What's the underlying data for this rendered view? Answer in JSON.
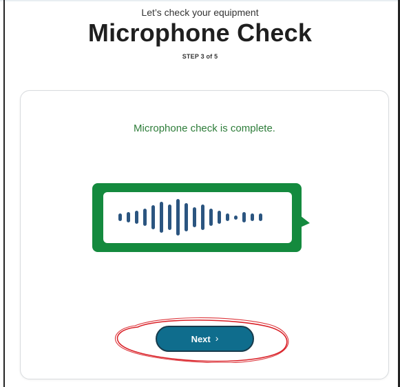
{
  "header": {
    "subtitle": "Let’s check your equipment",
    "title": "Microphone Check",
    "step": "STEP 3 of 5"
  },
  "card": {
    "status_message": "Microphone check is complete.",
    "next_button_label": "Next",
    "next_icon": "chevron-right-icon",
    "colors": {
      "status_text": "#2e7d3a",
      "bubble": "#148a3e",
      "wave": "#2b5580",
      "button": "#0f6d8d",
      "annotation": "#d91f26"
    }
  }
}
